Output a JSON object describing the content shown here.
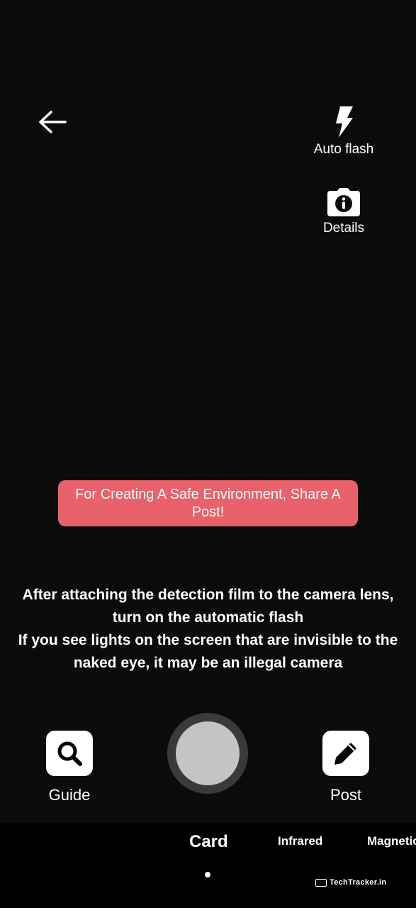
{
  "top": {
    "flash_label": "Auto flash",
    "details_label": "Details"
  },
  "banner": {
    "text": "For Creating A Safe Environment, Share A Post!"
  },
  "instructions": {
    "line1": "After attaching the detection film to the camera lens, turn on the automatic flash",
    "line2": "If you see lights on the screen that are invisible to the naked eye, it may be an illegal camera"
  },
  "controls": {
    "guide_label": "Guide",
    "post_label": "Post"
  },
  "modes": [
    "Card",
    "Infrared",
    "Magnetic"
  ],
  "watermark": "TechTracker.in",
  "colors": {
    "background": "#0b0b0b",
    "banner": "#e9616a",
    "shutter_inner": "#c4c4c4"
  }
}
